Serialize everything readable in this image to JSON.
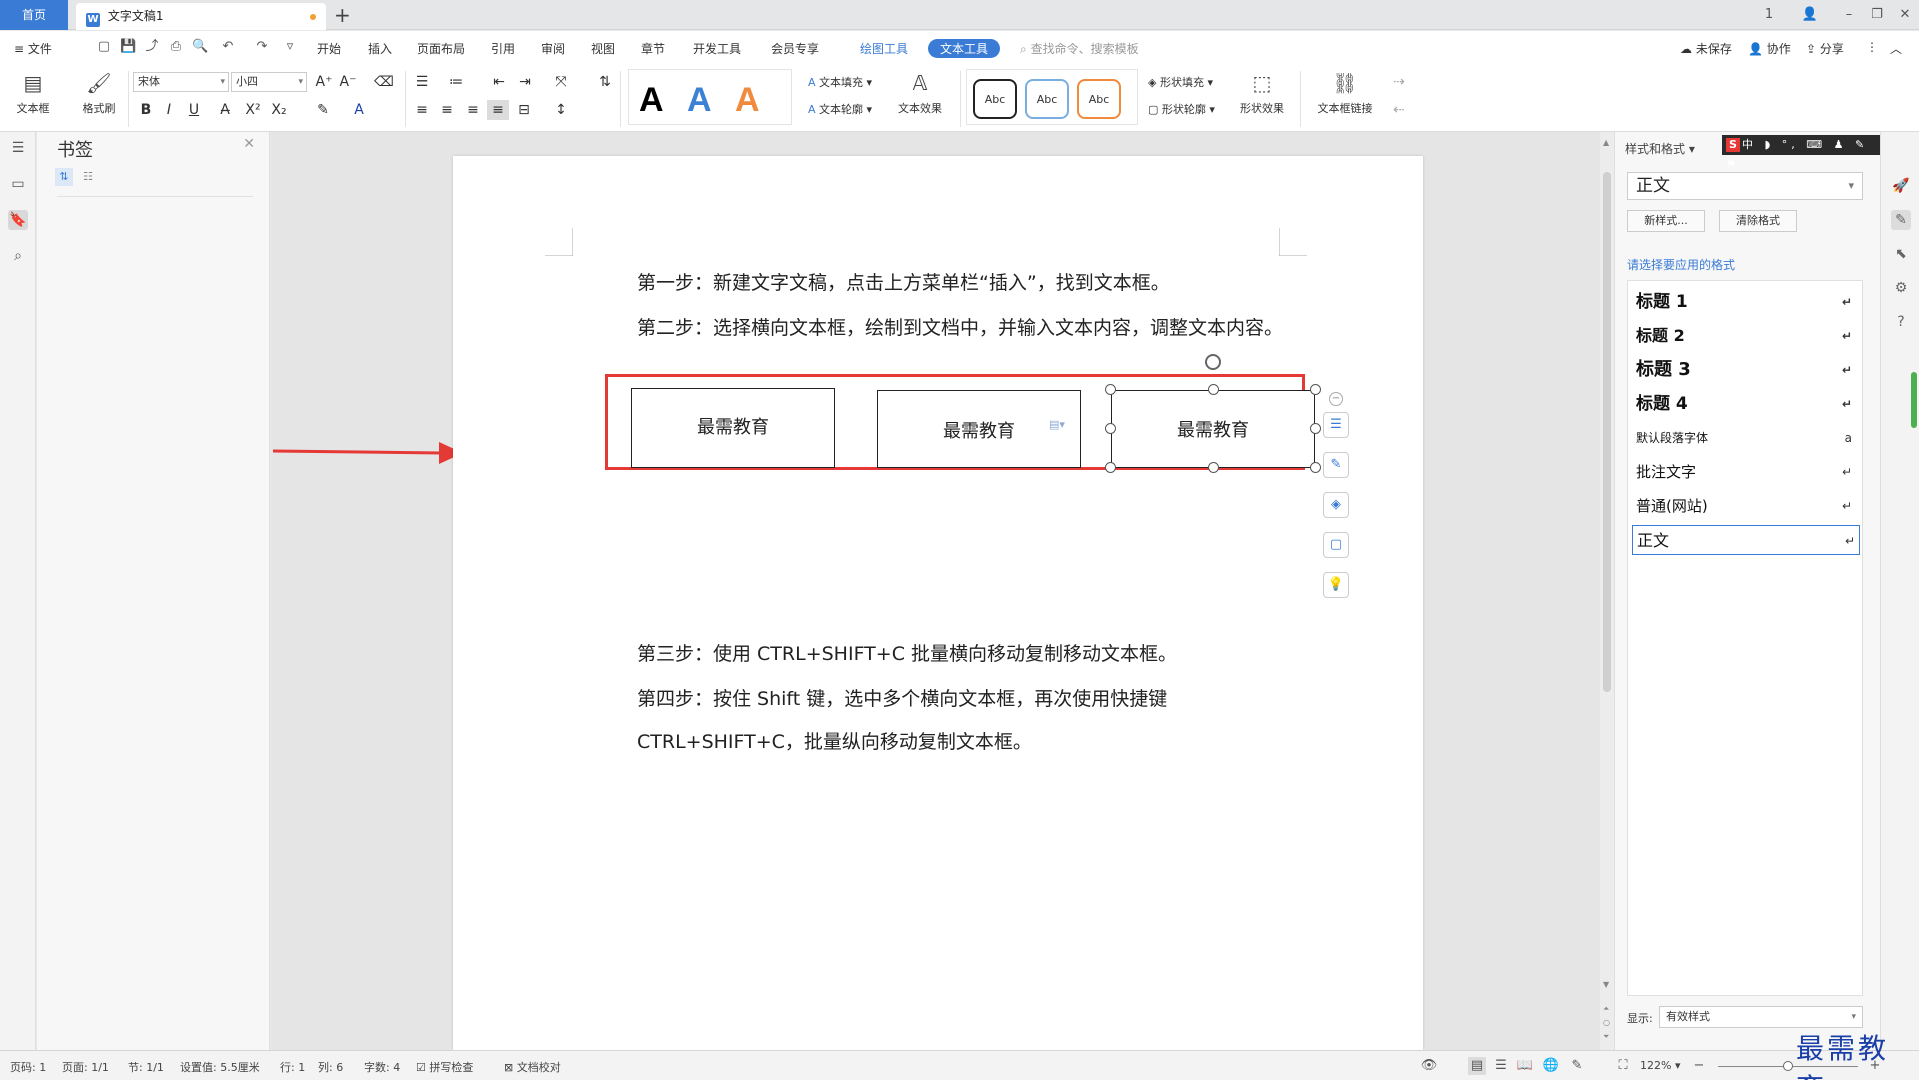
{
  "titlebar": {
    "home_tab": "首页",
    "doc_tab": "文字文稿1",
    "doc_icon": "W",
    "new_tab": "+",
    "win_controls": [
      "1",
      "👤",
      "–",
      "❐",
      "□",
      "✕"
    ]
  },
  "menubar": {
    "file": "≡ 文件",
    "items": [
      "开始",
      "插入",
      "页面布局",
      "引用",
      "审阅",
      "视图",
      "章节",
      "开发工具",
      "会员专享"
    ],
    "tool_tabs": [
      "绘图工具",
      "文本工具"
    ],
    "search": "查找命令、搜索模板",
    "unsaved": "未保存",
    "collab": "协作",
    "share": "分享"
  },
  "ribbon": {
    "textbox": "文本框",
    "format_painter": "格式刷",
    "font": "宋体",
    "size": "小四",
    "text_fill": "文本填充",
    "text_outline": "文本轮廓",
    "text_effect": "文本效果",
    "abc": [
      "Abc",
      "Abc",
      "Abc"
    ],
    "shape_fill": "形状填充",
    "shape_outline": "形状轮廓",
    "shape_effect": "形状效果",
    "textbox_link": "文本框链接",
    "bigA": [
      "A",
      "A",
      "A"
    ],
    "bigA_colors": [
      "#000000",
      "#3b82d6",
      "#f08a3c"
    ],
    "abc_border_colors": [
      "#222222",
      "#7aaee0",
      "#f08a3c"
    ]
  },
  "bookmark_panel": {
    "title": "书签",
    "close": "✕"
  },
  "document": {
    "para1": "第一步：新建文字文稿，点击上方菜单栏“插入”，找到文本框。",
    "para2": "第二步：选择横向文本框，绘制到文档中，并输入文本内容，调整文本内容。",
    "textboxes": [
      "最需教育",
      "最需教育",
      "最需教育"
    ],
    "para3": "第三步：使用 CTRL+SHIFT+C 批量横向移动复制移动文本框。",
    "para4": "第四步：按住 Shift 键，选中多个横向文本框，再次使用快捷键",
    "para5": "CTRL+SHIFT+C，批量纵向移动复制文本框。"
  },
  "style_panel": {
    "header": "样式和格式",
    "current": "正文",
    "new_style": "新样式...",
    "clear_format": "清除格式",
    "apply_label": "请选择要应用的格式",
    "items": [
      "标题 1",
      "标题 2",
      "标题 3",
      "标题 4",
      "默认段落字体",
      "批注文字",
      "普通(网站)",
      "正文"
    ],
    "show_label": "显示:",
    "show_value": "有效样式"
  },
  "ime": {
    "s": "S",
    "rest": "中 ◗ °, ⌨ ♟ ✎ ⚑"
  },
  "statusbar": {
    "page_code": "页码: 1",
    "page": "页面: 1/1",
    "section": "节: 1/1",
    "setting": "设置值: 5.5厘米",
    "row": "行: 1",
    "col": "列: 6",
    "words": "字数: 4",
    "spell": "拼写检查",
    "proof": "文档校对",
    "zoom": "122%"
  },
  "watermark": "最需教育",
  "colors": {
    "accent": "#3a7bd5",
    "highlight_frame": "#e53935",
    "arrow": "#e53935"
  }
}
